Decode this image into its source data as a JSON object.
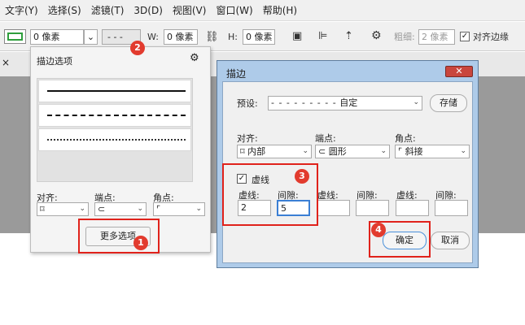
{
  "menubar": {
    "items": [
      "文字(Y)",
      "选择(S)",
      "滤镜(T)",
      "3D(D)",
      "视图(V)",
      "窗口(W)",
      "帮助(H)"
    ]
  },
  "optbar": {
    "stroke_width_value": "0 像素",
    "w_label": "W:",
    "w_value": "0 像素",
    "h_label": "H:",
    "h_value": "0 像素",
    "weight_label": "粗细:",
    "weight_value": "2 像素",
    "align_edges_label": "对齐边缘"
  },
  "stroke_panel": {
    "title": "描边选项",
    "align_label": "对齐:",
    "caps_label": "端点:",
    "corners_label": "角点:",
    "more_options_label": "更多选项"
  },
  "dialog": {
    "title": "描边",
    "preset_label": "预设:",
    "preset_value": "自定",
    "save_label": "存储",
    "align_label": "对齐:",
    "align_value": "内部",
    "caps_label": "端点:",
    "caps_value": "圆形",
    "corners_label": "角点:",
    "corners_value": "斜接",
    "dashed_label": "虚线",
    "dashed_checked": true,
    "dash_cols": [
      "虚线:",
      "间隙:",
      "虚线:",
      "间隙:",
      "虚线:",
      "间隙:"
    ],
    "dash_values": [
      "2",
      "5",
      "",
      "",
      "",
      ""
    ],
    "ok_label": "确定",
    "cancel_label": "取消"
  },
  "badges": {
    "b1": "1",
    "b2": "2",
    "b3": "3",
    "b4": "4"
  },
  "colors": {
    "badge": "#e23b2e",
    "highlight": "#e0221b",
    "dialog_frame": "#aecbe9",
    "stroke_swatch": "#2e9e3c"
  }
}
